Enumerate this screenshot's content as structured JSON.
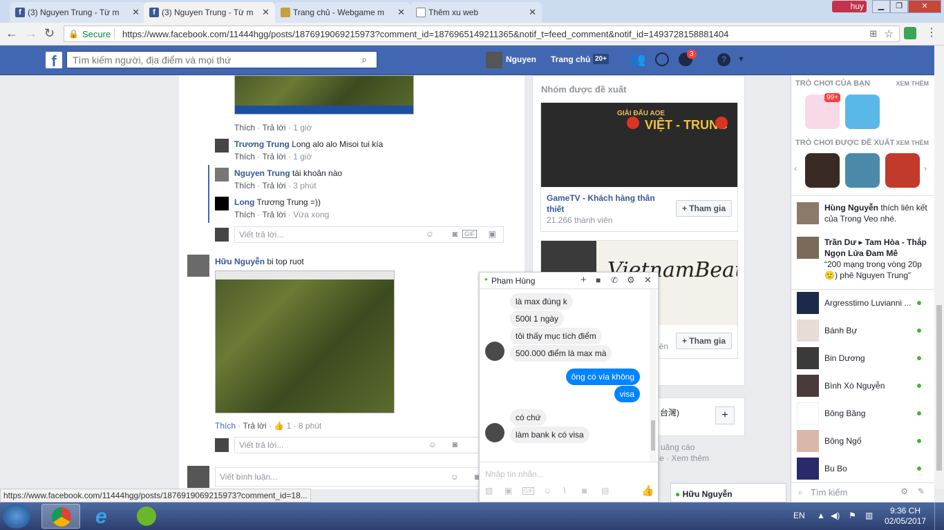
{
  "browser": {
    "tabs": [
      {
        "title": "(3) Nguyen Trung - Từ m"
      },
      {
        "title": "(3) Nguyen Trung - Từ m"
      },
      {
        "title": "Trang chủ - Webgame m"
      },
      {
        "title": "Thêm xu web"
      }
    ],
    "profile": "huy",
    "secure_label": "Secure",
    "url": "https://www.facebook.com/11444hgg/posts/1876919069215973?comment_id=1876965149211365&notif_t=feed_comment&notif_id=1493728158881404",
    "status_url": "https://www.facebook.com/11444hgg/posts/1876919069215973?comment_id=18..."
  },
  "fb_header": {
    "search_placeholder": "Tìm kiếm người, địa điểm và mọi thứ",
    "user_name": "Nguyen",
    "home_label": "Trang chủ",
    "home_badge": "20+",
    "notif_badge": "3"
  },
  "comments": {
    "c1_actions": {
      "like": "Thích",
      "reply": "Trả lời",
      "time": "1 giờ"
    },
    "c2": {
      "name": "Trương Trung",
      "text": "Long alo alo Misoi tui kía",
      "like": "Thích",
      "reply": "Trả lời",
      "time": "1 giờ"
    },
    "c3": {
      "name": "Nguyen Trung",
      "text": "tài khoản nào",
      "like": "Thích",
      "reply": "Trả lời",
      "time": "3 phút"
    },
    "c4": {
      "name": "Long",
      "text": "Trương Trung =))",
      "like": "Thích",
      "reply": "Trả lời",
      "time": "Vừa xong"
    },
    "reply_placeholder": "Viết trả lời...",
    "c5": {
      "name": "Hữu Nguyễn",
      "text": "bi top ruot",
      "like": "Thích",
      "reply": "Trả lời",
      "likes": "1",
      "time": "8 phút"
    },
    "comment_placeholder": "Viết bình luận..."
  },
  "groups": {
    "title": "Nhóm được đề xuất",
    "g1": {
      "banner_top": "GIẢI ĐẤU AOE",
      "banner": "VIỆT - TRUNG",
      "name": "GameTV - Khách hàng thân thiết",
      "members": "21.266 thành viên",
      "join": "+ Tham gia"
    },
    "g2": {
      "banner": "VietnamBeauty Art",
      "join": "+ Tham gia"
    },
    "partial_1": "iên",
    "partial_2": "台灣)",
    "ads_label": "uảng cáo",
    "more_label": "e · Xem thêm"
  },
  "sidebar": {
    "your_games": "TRÒ CHƠI CỦA BẠN",
    "see_more": "XEM THÊM",
    "game_badge": "99+",
    "suggested_games": "TRÒ CHƠI ĐƯỢC ĐỀ XUẤT",
    "see_more_2": "XEM THÊM",
    "ticker1": {
      "name": "Hùng Nguyễn",
      "text": "thích liên kết của Trong Veo nhé."
    },
    "ticker2": {
      "name": "Trần Dư",
      "target": "Tam Hòa - Thắp Ngọn Lửa Đam Mê",
      "text": "“200 mạng trong vòng 20p 🙂) phê Nguyen Trung”"
    },
    "contacts": [
      {
        "name": "Argresstimo Luvianni ..."
      },
      {
        "name": "Bánh Bự"
      },
      {
        "name": "Bin Dương"
      },
      {
        "name": "Bình Xò Nguyễn"
      },
      {
        "name": "Bông Băng"
      },
      {
        "name": "Bông Ngố"
      },
      {
        "name": "Bu Bo"
      }
    ],
    "search_placeholder": "Tìm kiếm"
  },
  "chat": {
    "contact": "Phạm Hùng",
    "messages": [
      {
        "text": "là max đúng k"
      },
      {
        "text": "500l 1 ngày"
      },
      {
        "text": "tôi thấy mục tích điểm"
      },
      {
        "text": "500.000 điểm là max mà"
      },
      {
        "text": "ông có vía không"
      },
      {
        "text": "visa"
      },
      {
        "text": "có chứ"
      },
      {
        "text": "làm bank k có visa"
      }
    ],
    "input_placeholder": "Nhập tin nhắn..."
  },
  "minichat": {
    "name": "Hữu Nguyễn"
  },
  "taskbar": {
    "lang": "EN",
    "time": "9:36 CH",
    "date": "02/05/2017"
  }
}
